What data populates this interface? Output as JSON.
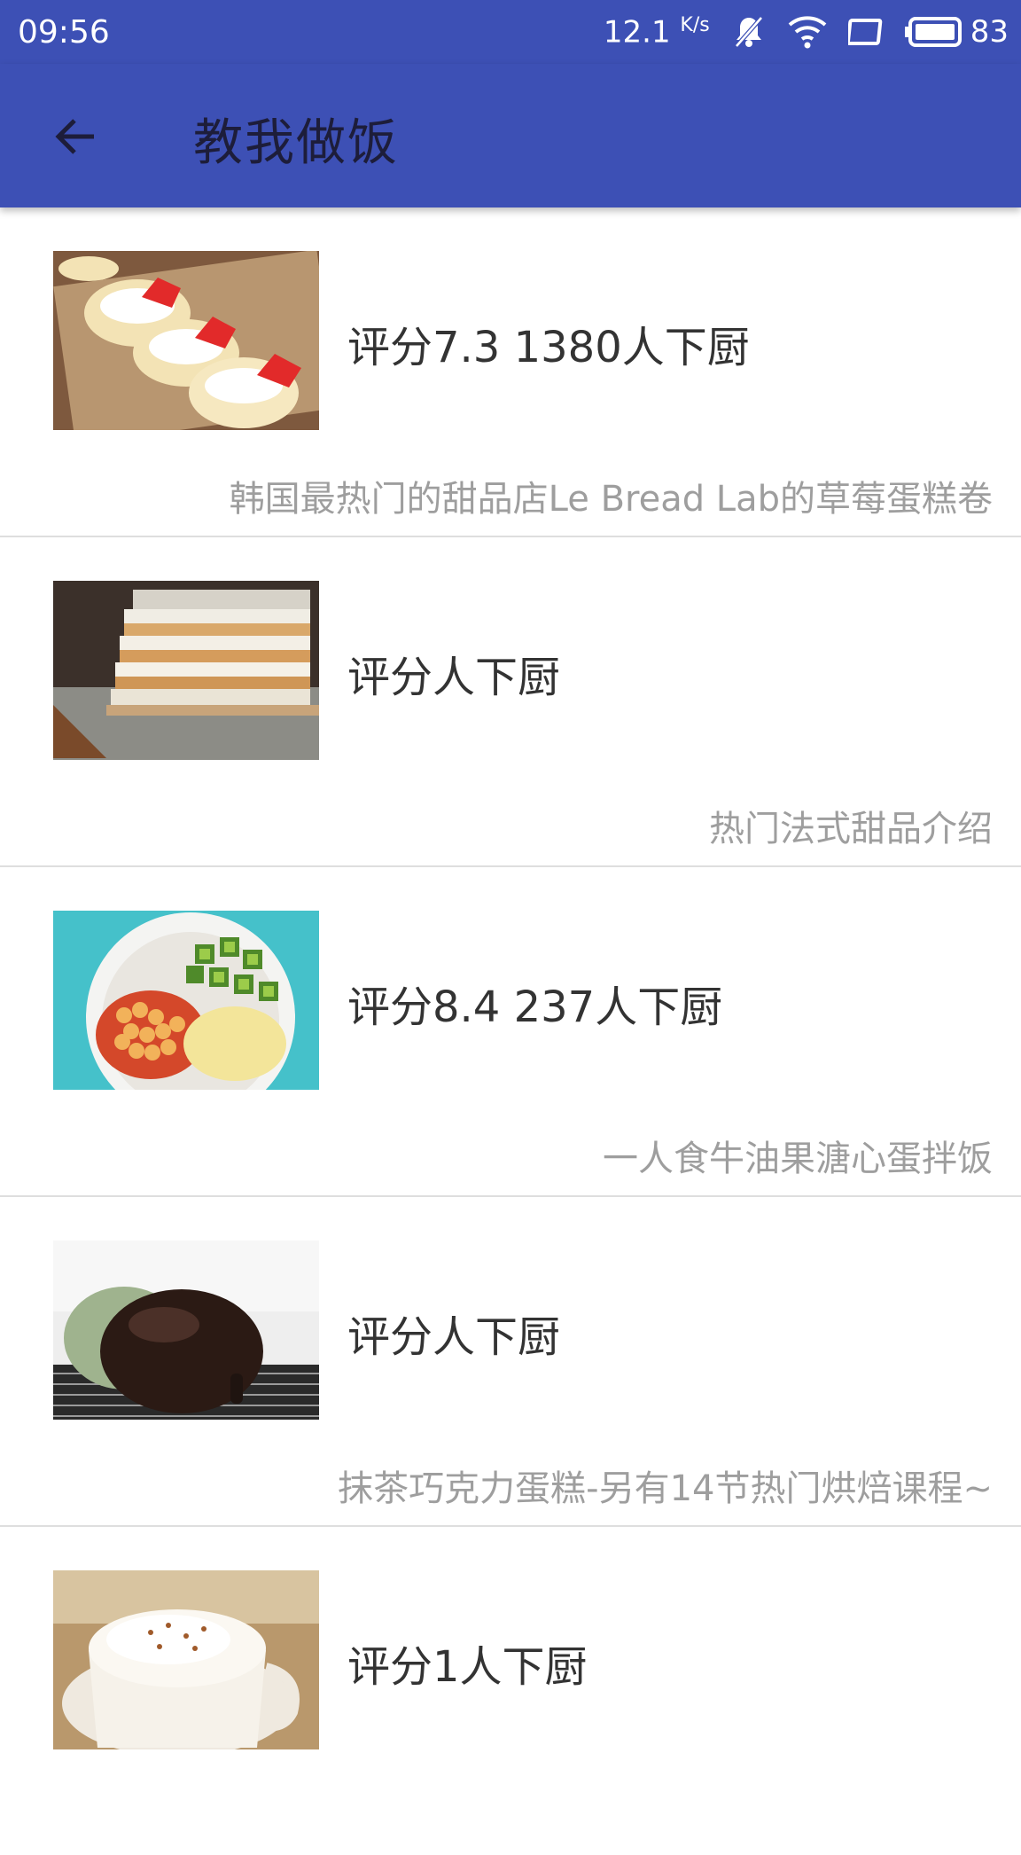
{
  "status_bar": {
    "time": "09:56",
    "speed": "12.1",
    "speed_unit": "K/s",
    "battery": "83",
    "icons": [
      "mute-bell-icon",
      "wifi-icon",
      "screen-icon",
      "battery-icon"
    ]
  },
  "toolbar": {
    "title": "教我做饭",
    "back_icon": "arrow-left-icon",
    "bg_color": "#3d50b5"
  },
  "recipes": [
    {
      "rating": "评分7.3 1380人下厨",
      "description": "韩国最热门的甜品店Le Bread Lab的草莓蛋糕卷",
      "image": "strawberry-cream-rolls"
    },
    {
      "rating": "评分人下厨",
      "description": "热门法式甜品介绍",
      "image": "mille-feuille"
    },
    {
      "rating": "评分8.4 237人下厨",
      "description": "一人食牛油果溏心蛋拌饭",
      "image": "avocado-beans-egg-bowl"
    },
    {
      "rating": "评分人下厨",
      "description": "抹茶巧克力蛋糕-另有14节热门烘焙课程~",
      "image": "matcha-chocolate-mousse-cake"
    },
    {
      "rating": "评分1人下厨",
      "description": "",
      "image": "cream-coffee-cup"
    }
  ]
}
